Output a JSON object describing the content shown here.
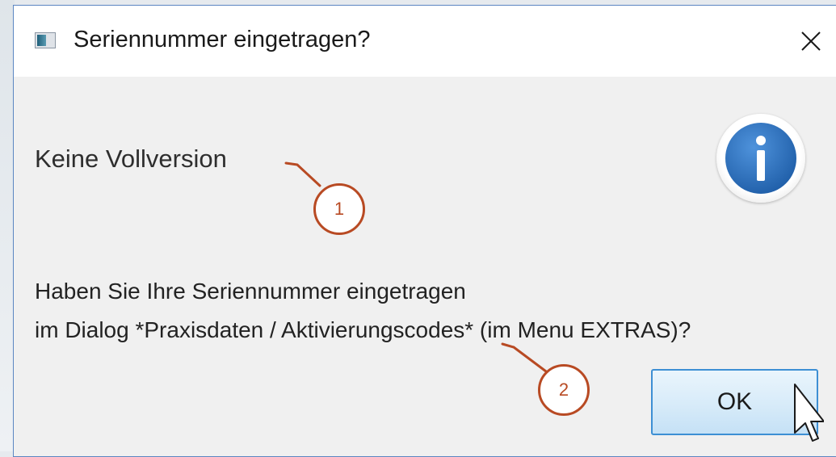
{
  "window": {
    "title": "Seriennummer eingetragen?"
  },
  "header": {
    "text": "Keine Vollversion"
  },
  "message": {
    "line1": "Haben Sie Ihre Seriennummer eingetragen",
    "line2": "im Dialog *Praxisdaten / Aktivierungscodes* (im Menu EXTRAS)?"
  },
  "buttons": {
    "ok_label": "OK"
  },
  "callouts": [
    {
      "label": "1"
    },
    {
      "label": "2"
    }
  ],
  "icons": {
    "app": "app-window-icon",
    "close": "close-icon",
    "info": "info-icon",
    "cursor": "mouse-pointer-icon"
  },
  "colors": {
    "callout": "#b84a23",
    "info_blue": "#2f74c0",
    "button_border": "#3d8fd4",
    "window_border": "#5b86c2"
  }
}
